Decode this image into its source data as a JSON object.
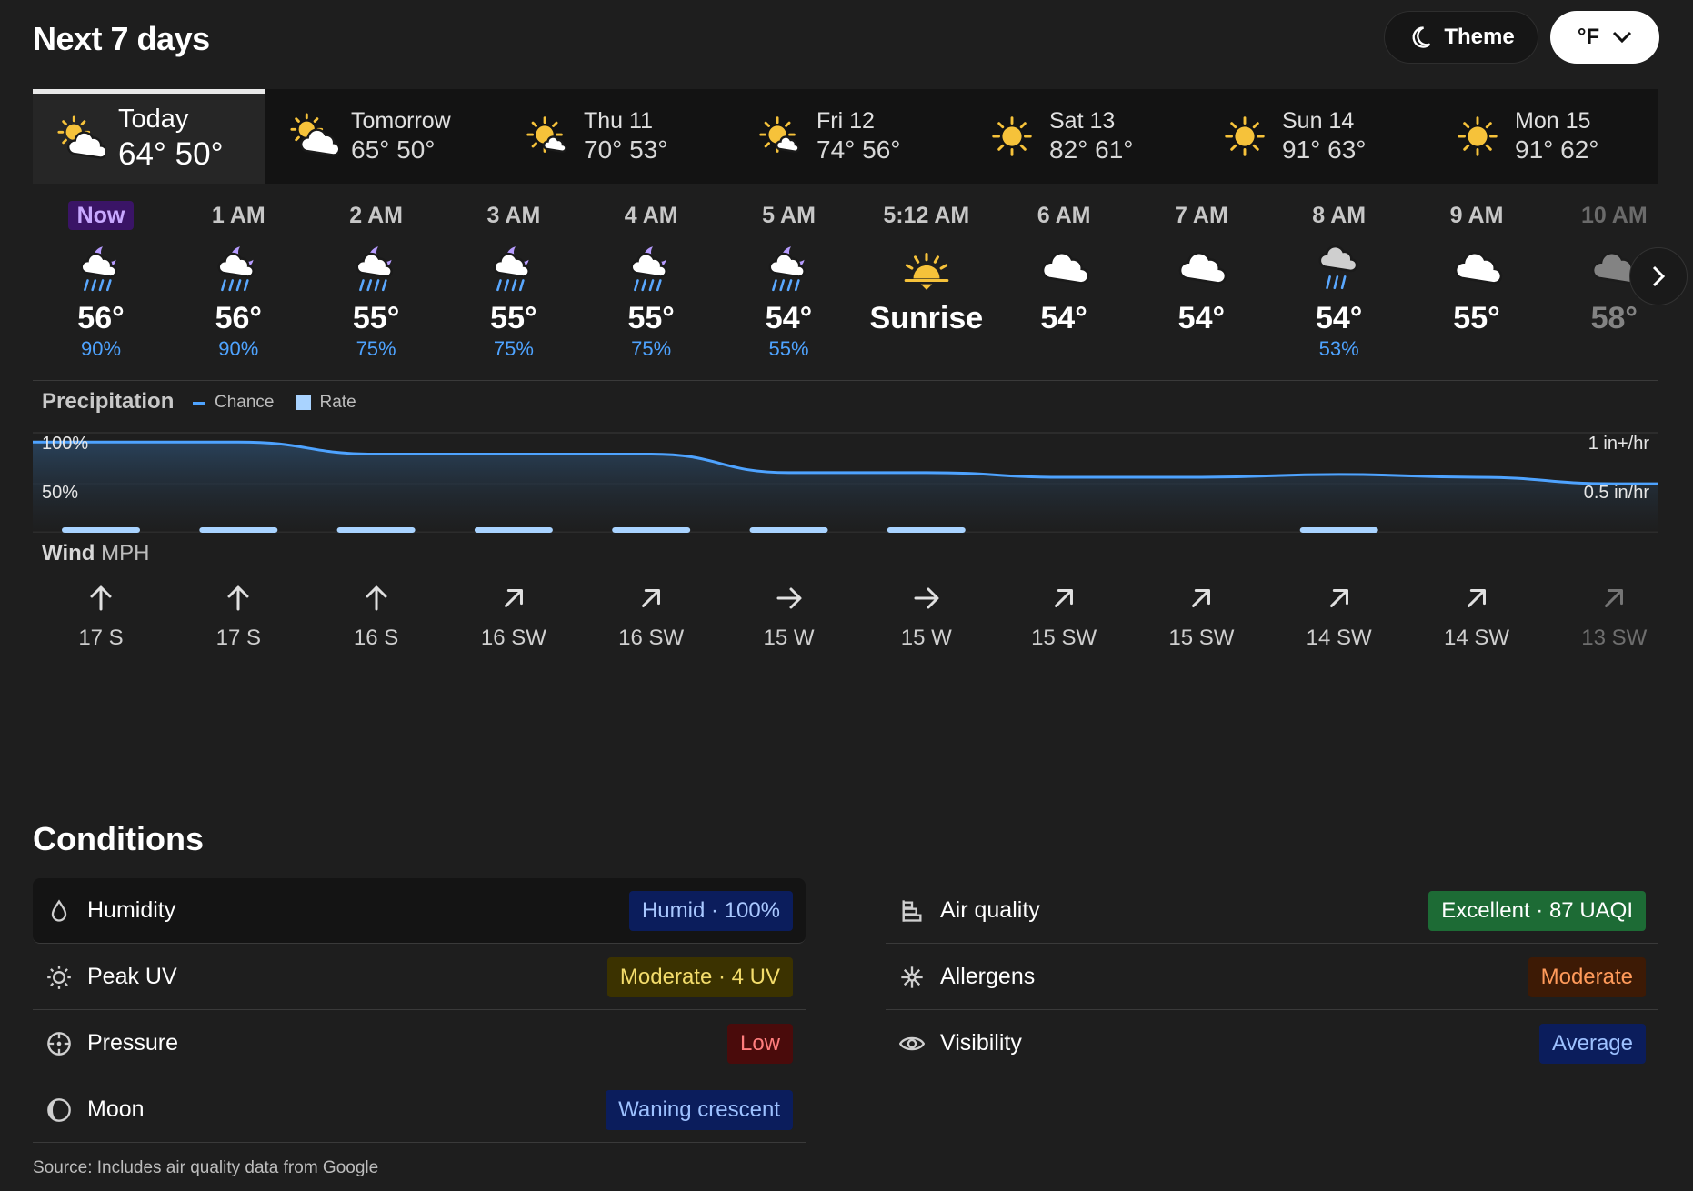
{
  "header": {
    "title": "Next 7 days",
    "theme_label": "Theme",
    "unit_label": "°F"
  },
  "days": [
    {
      "name": "Today",
      "temps": "64° 50°",
      "icon": "partly-cloudy-sun-icon"
    },
    {
      "name": "Tomorrow",
      "temps": "65° 50°",
      "icon": "partly-cloudy-sun-icon"
    },
    {
      "name": "Thu 11",
      "temps": "70° 53°",
      "icon": "mostly-sunny-icon"
    },
    {
      "name": "Fri 12",
      "temps": "74° 56°",
      "icon": "mostly-sunny-icon"
    },
    {
      "name": "Sat 13",
      "temps": "82° 61°",
      "icon": "sun-icon"
    },
    {
      "name": "Sun 14",
      "temps": "91° 63°",
      "icon": "sun-icon"
    },
    {
      "name": "Mon 15",
      "temps": "91° 62°",
      "icon": "sun-icon"
    }
  ],
  "hours": [
    {
      "label": "Now",
      "temp": "56°",
      "pct": "90%",
      "icon": "night-rain-icon"
    },
    {
      "label": "1 AM",
      "temp": "56°",
      "pct": "90%",
      "icon": "night-rain-icon"
    },
    {
      "label": "2 AM",
      "temp": "55°",
      "pct": "75%",
      "icon": "night-rain-icon"
    },
    {
      "label": "3 AM",
      "temp": "55°",
      "pct": "75%",
      "icon": "night-rain-icon"
    },
    {
      "label": "4 AM",
      "temp": "55°",
      "pct": "75%",
      "icon": "night-rain-icon"
    },
    {
      "label": "5 AM",
      "temp": "54°",
      "pct": "55%",
      "icon": "night-rain-icon"
    },
    {
      "label": "5:12 AM",
      "temp": "Sunrise",
      "pct": "",
      "icon": "sunrise-icon"
    },
    {
      "label": "6 AM",
      "temp": "54°",
      "pct": "",
      "icon": "cloud-icon"
    },
    {
      "label": "7 AM",
      "temp": "54°",
      "pct": "",
      "icon": "cloud-icon"
    },
    {
      "label": "8 AM",
      "temp": "54°",
      "pct": "53%",
      "icon": "rain-icon"
    },
    {
      "label": "9 AM",
      "temp": "55°",
      "pct": "",
      "icon": "cloud-icon"
    },
    {
      "label": "10 AM",
      "temp": "58°",
      "pct": "",
      "icon": "cloud-icon"
    }
  ],
  "precipitation": {
    "title": "Precipitation",
    "legend_chance": "Chance",
    "legend_rate": "Rate",
    "y_left": [
      "100%",
      "50%"
    ],
    "y_right": [
      "1 in+/hr",
      "0.5 in/hr"
    ],
    "chance": [
      90,
      90,
      77,
      77,
      77,
      57,
      57,
      52,
      52,
      55,
      52,
      45
    ],
    "rate_bars": [
      true,
      true,
      true,
      true,
      true,
      true,
      true,
      false,
      false,
      true,
      false,
      false
    ]
  },
  "wind": {
    "title": "Wind",
    "unit": "MPH",
    "items": [
      {
        "value": "17 S",
        "dir": "n"
      },
      {
        "value": "17 S",
        "dir": "n"
      },
      {
        "value": "16 S",
        "dir": "n"
      },
      {
        "value": "16 SW",
        "dir": "ne"
      },
      {
        "value": "16 SW",
        "dir": "ne"
      },
      {
        "value": "15 W",
        "dir": "e"
      },
      {
        "value": "15 W",
        "dir": "e"
      },
      {
        "value": "15 SW",
        "dir": "ne"
      },
      {
        "value": "15 SW",
        "dir": "ne"
      },
      {
        "value": "14 SW",
        "dir": "ne"
      },
      {
        "value": "14 SW",
        "dir": "ne"
      },
      {
        "value": "13 SW",
        "dir": "ne"
      }
    ]
  },
  "conditions": {
    "title": "Conditions",
    "left": [
      {
        "label": "Humidity",
        "value": "Humid · 100%",
        "icon": "droplet-icon"
      },
      {
        "label": "Peak UV",
        "value": "Moderate · 4 UV",
        "icon": "uv-sun-icon"
      },
      {
        "label": "Pressure",
        "value": "Low",
        "icon": "gauge-icon"
      },
      {
        "label": "Moon",
        "value": "Waning crescent",
        "icon": "moon-icon"
      }
    ],
    "right": [
      {
        "label": "Air quality",
        "value": "Excellent · 87 UAQI",
        "icon": "air-quality-icon"
      },
      {
        "label": "Allergens",
        "value": "Moderate",
        "icon": "pollen-icon"
      },
      {
        "label": "Visibility",
        "value": "Average",
        "icon": "eye-icon"
      }
    ]
  },
  "source": "Source: Includes air quality data from Google",
  "colors": {
    "background": "#1e1e1e",
    "accent_blue": "#4ea3ff",
    "rate_bar": "#a9d3ff"
  }
}
